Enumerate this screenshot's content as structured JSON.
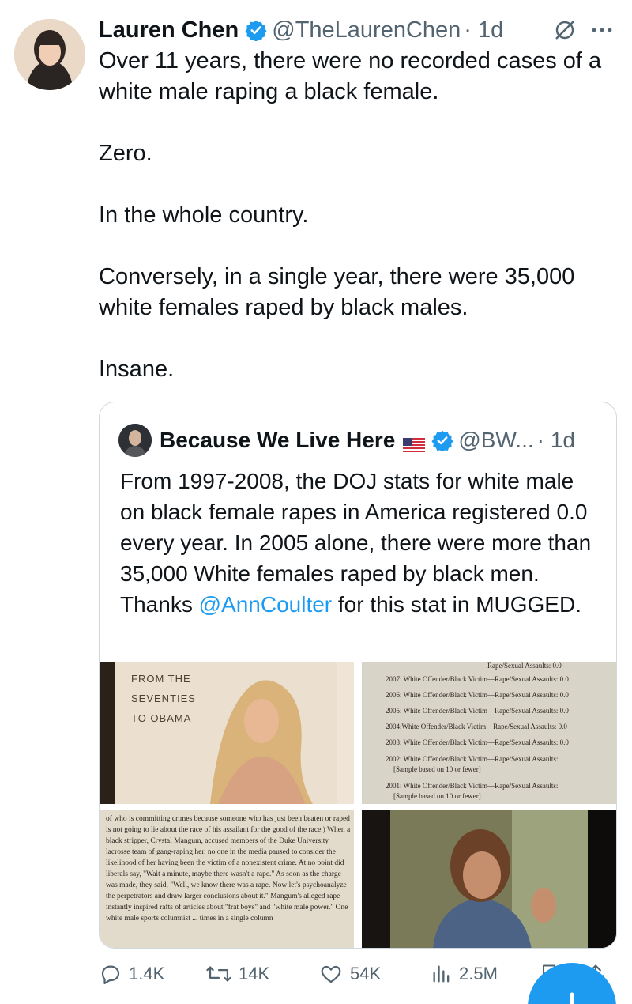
{
  "tweet": {
    "author_name": "Lauren Chen",
    "handle": "@TheLaurenChen",
    "time": "· 1d",
    "paragraphs": [
      "Over 11 years, there were no recorded cases of a white male raping a black female.",
      "Zero.",
      "In the whole country.",
      "Conversely, in a single year, there were 35,000 white females raped by black males.",
      "Insane."
    ]
  },
  "quote": {
    "author_name": "Because We Live Here",
    "flag": "🇺🇸",
    "handle": "@BW...",
    "time": "· 1d",
    "text_before": "From 1997-2008, the DOJ stats for white male on black female rapes in America registered 0.0 every year. In 2005 alone, there were more than 35,000 White females raped by black men. Thanks ",
    "mention": "@AnnCoulter",
    "text_after": " for this stat in MUGGED.",
    "images": {
      "cover_text": [
        "FROM THE",
        "SEVENTIES",
        "TO OBAMA"
      ],
      "stats_lines": [
        "—Rape/Sexual Assaults: 0.0",
        "2007: White Offender/Black Victim—Rape/Sexual Assaults: 0.0",
        "2006: White Offender/Black Victim—Rape/Sexual Assaults: 0.0",
        "2005: White Offender/Black Victim—Rape/Sexual Assaults: 0.0",
        "2004:White Offender/Black Victim—Rape/Sexual Assaults: 0.0",
        "2003: White Offender/Black Victim—Rape/Sexual Assaults: 0.0",
        "2002: White Offender/Black Victim—Rape/Sexual Assaults:",
        "[Sample based on 10 or fewer]",
        "2001: White Offender/Black Victim—Rape/Sexual Assaults:",
        "[Sample based on 10 or fewer]"
      ],
      "page_text": "of who is committing crimes because someone who has just been beaten or raped is not going to lie about the race of his assailant for the good of the race.) When a black stripper, Crystal Mangum, accused members of the Duke University lacrosse team of gang-raping her, no one in the media paused to consider the likelihood of her having been the victim of a nonexistent crime. At no point did liberals say, \"Wait a minute, maybe there wasn't a rape.\" As soon as the charge was made, they said, \"Well, we know there was a rape. Now let's psychoanalyze the perpetrators and draw larger conclusions about it.\" Mangum's alleged rape instantly inspired rafts of articles about \"frat boys\" and \"white male power.\" One white male sports columnist ... times in a single column"
    }
  },
  "actions": {
    "replies": "1.4K",
    "retweets": "14K",
    "likes": "54K",
    "views": "2.5M"
  },
  "colors": {
    "accent": "#1d9bf0",
    "text": "#0f1419",
    "muted": "#536471",
    "border": "#cfd9de"
  }
}
